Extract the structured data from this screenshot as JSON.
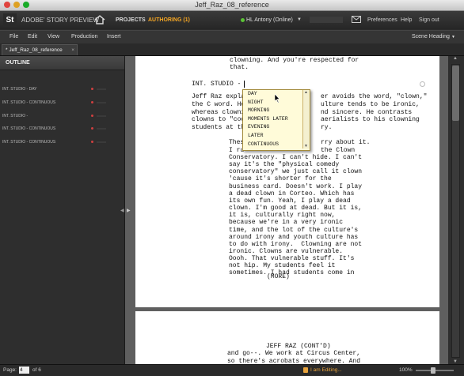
{
  "window": {
    "title": "Jeff_Raz_08_reference"
  },
  "app_bar": {
    "logo": "St",
    "app_name": "ADOBE' STORY PREVIEW",
    "nav_projects": "PROJECTS",
    "nav_authoring": "AUTHORING (1)",
    "user": "HL Antony (Online)",
    "prefs": "Preferences",
    "help": "Help",
    "signout": "Sign out"
  },
  "menu": {
    "items": [
      "File",
      "Edit",
      "View",
      "Production",
      "Insert"
    ],
    "format": "Scene Heading"
  },
  "tabs": [
    {
      "label": "* Jeff_Raz_08_reference"
    }
  ],
  "outline": {
    "title": "OUTLINE",
    "items": [
      {
        "label": "INT. STUDIO - DAY"
      },
      {
        "label": "INT. STUDIO - CONTINUOUS"
      },
      {
        "label": "INT. STUDIO -"
      },
      {
        "label": "INT. STUDIO - CONTINUOUS"
      },
      {
        "label": "INT. STUDIO - CONTINUOUS"
      }
    ]
  },
  "script_lines": {
    "l0": "clowning. And you're respected for",
    "l1": "that.",
    "heading": "INT. STUDIO - ",
    "action": [
      "Jeff Raz expla",
      "whereas clowni",
      "clowns to \"coo",
      "students at th"
    ],
    "action_right": [
      "er avoids the word, \"clown,\"",
      "ulture tends to be ironic,",
      "nd sincere. He contrasts",
      "aerialists to his clowning",
      "ry."
    ],
    "action_mid": [
      "the C word. He"
    ],
    "dialogue_top": [
      "Thes",
      "I ru"
    ],
    "dialogue_top_right": [
      "rry about it.",
      "the Clown"
    ],
    "dialogue": [
      "Conservatory. I can't hide. I can't",
      "say it's the \"physical comedy",
      "conservatory\" we just call it clown",
      "'cause it's shorter for the",
      "business card. Doesn't work. I play",
      "a dead clown in Corteo. Which has",
      "its own fun. Yeah, I play a dead",
      "clown. I'm good at dead. But it is,",
      "it is, culturally right now,",
      "because we're in a very ironic",
      "time, and the lot of the culture's",
      "around irony and youth culture has",
      "to do with irony.  Clowning are not",
      "ironic. Clowns are vulnerable.",
      "Oooh. That vulnerable stuff. It's",
      "not hip. My students feel it",
      "sometimes. I had students come in"
    ],
    "more": "(MORE)",
    "cont_char": "JEFF RAZ (CONT'D)",
    "cont_lines": [
      "and go--. We work at Circus Center,",
      "so there's acrobats everywhere. And"
    ]
  },
  "autocomplete": {
    "options": [
      "DAY",
      "NIGHT",
      "MORNING",
      "MOMENTS LATER",
      "EVENING",
      "LATER",
      "CONTINUOUS"
    ],
    "selected_index": 0
  },
  "status": {
    "page_label": "Page:",
    "page_value": "4",
    "page_of": "of 6",
    "editing": "I am Editing...",
    "zoom": "100%"
  }
}
